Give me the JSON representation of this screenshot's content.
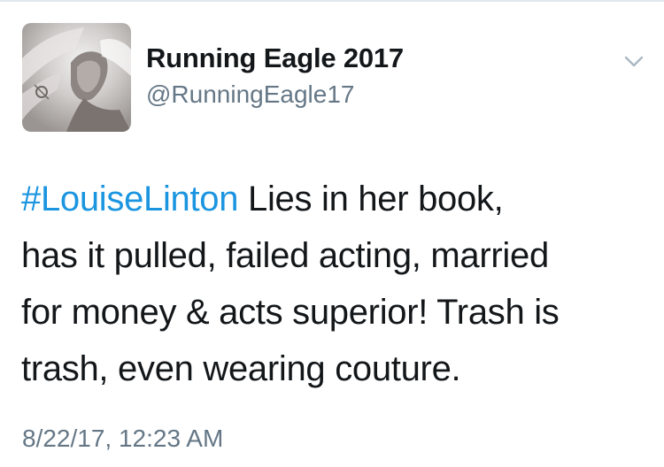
{
  "user": {
    "display_name": "Running Eagle 2017",
    "handle": "@RunningEagle17"
  },
  "menu": {
    "icon": "chevron-down-icon"
  },
  "tweet": {
    "hashtag": "#LouiseLinton",
    "line1_rest": " Lies in her book,",
    "line2": "has it pulled, failed acting, married",
    "line3": "for money & acts superior! Trash is",
    "line4": "trash, even wearing couture."
  },
  "timestamp": "8/22/17, 12:23 AM",
  "colors": {
    "link": "#1b95e0",
    "text": "#14171a",
    "secondary": "#657786"
  }
}
